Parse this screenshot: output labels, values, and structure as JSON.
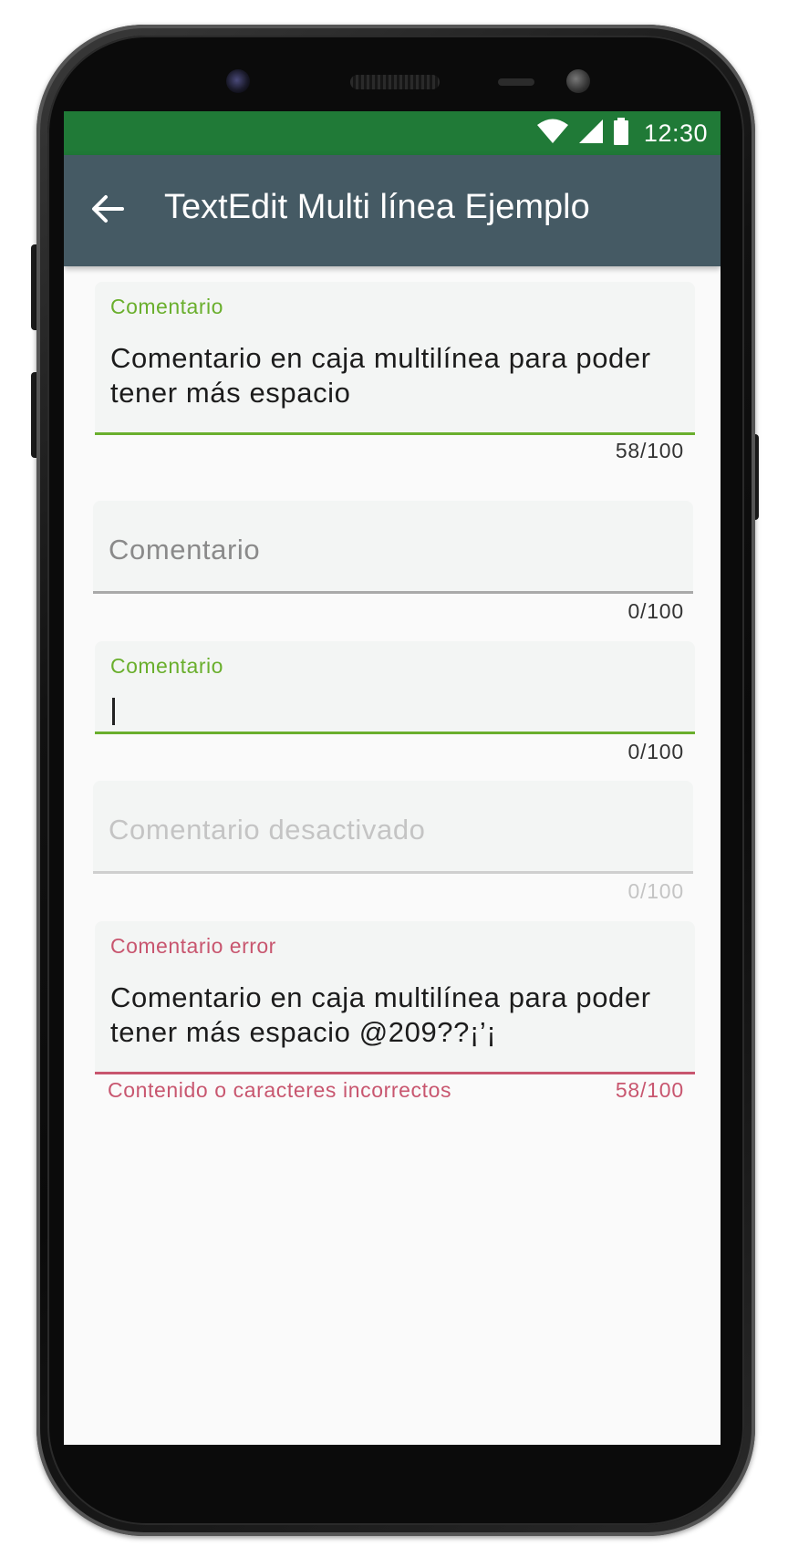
{
  "colors": {
    "status_bar": "#207a37",
    "app_bar": "#455a64",
    "accent_green": "#6aaf2d",
    "error_red": "#c8566f",
    "screen_bg": "#fafafa",
    "field_bg": "#f3f5f4"
  },
  "status_bar": {
    "icons": [
      "wifi-icon",
      "signal-icon",
      "battery-icon"
    ],
    "time": "12:30"
  },
  "app_bar": {
    "back_icon": "arrow-back-icon",
    "title": "TextEdit Multi línea Ejemplo"
  },
  "fields": [
    {
      "state": "focused-filled",
      "label": "Comentario",
      "value": "Comentario en caja multilínea para poder tener más espacio",
      "counter": "58/100"
    },
    {
      "state": "empty",
      "placeholder": "Comentario",
      "counter": "0/100"
    },
    {
      "state": "focused-empty",
      "label": "Comentario",
      "value": "",
      "counter": "0/100"
    },
    {
      "state": "disabled",
      "placeholder": "Comentario desactivado",
      "counter": "0/100"
    },
    {
      "state": "error",
      "label": "Comentario error",
      "value": "Comentario en caja multilínea para poder tener más espacio @209??¡’¡",
      "helper": "Contenido o caracteres incorrectos",
      "counter": "58/100"
    }
  ]
}
